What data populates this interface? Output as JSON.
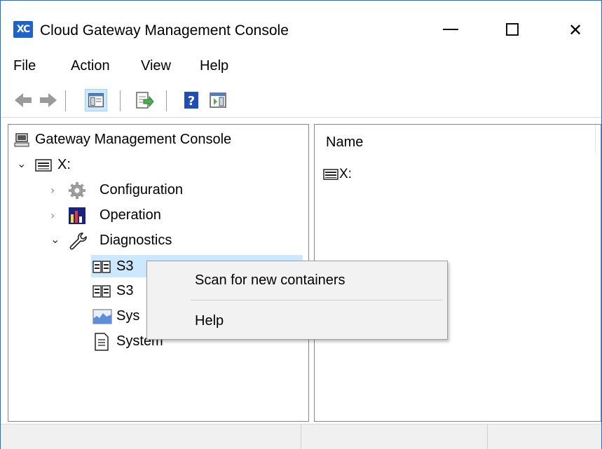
{
  "window": {
    "title": "Cloud Gateway Management Console",
    "app_icon_text": "XC",
    "accent_color": "#1e63c8"
  },
  "menu": [
    "File",
    "Action",
    "View",
    "Help"
  ],
  "toolbar": {
    "icons": [
      "back-arrow-icon",
      "forward-arrow-icon",
      "show-hide-console-tree-icon",
      "export-list-icon",
      "help-icon",
      "show-hide-action-pane-icon"
    ]
  },
  "tree": {
    "root": "Gateway Management Console",
    "drive": "X:",
    "configuration": "Configuration",
    "operation": "Operation",
    "diagnostics": "Diagnostics",
    "s3_1_visible": "S3",
    "s3_2_visible": "S3",
    "sys_visible": "Sys",
    "system": "System"
  },
  "list_view": {
    "column_name": "Name",
    "rows": [
      "X:"
    ]
  },
  "context_menu": {
    "items": [
      "Scan for new containers",
      "Help"
    ]
  }
}
